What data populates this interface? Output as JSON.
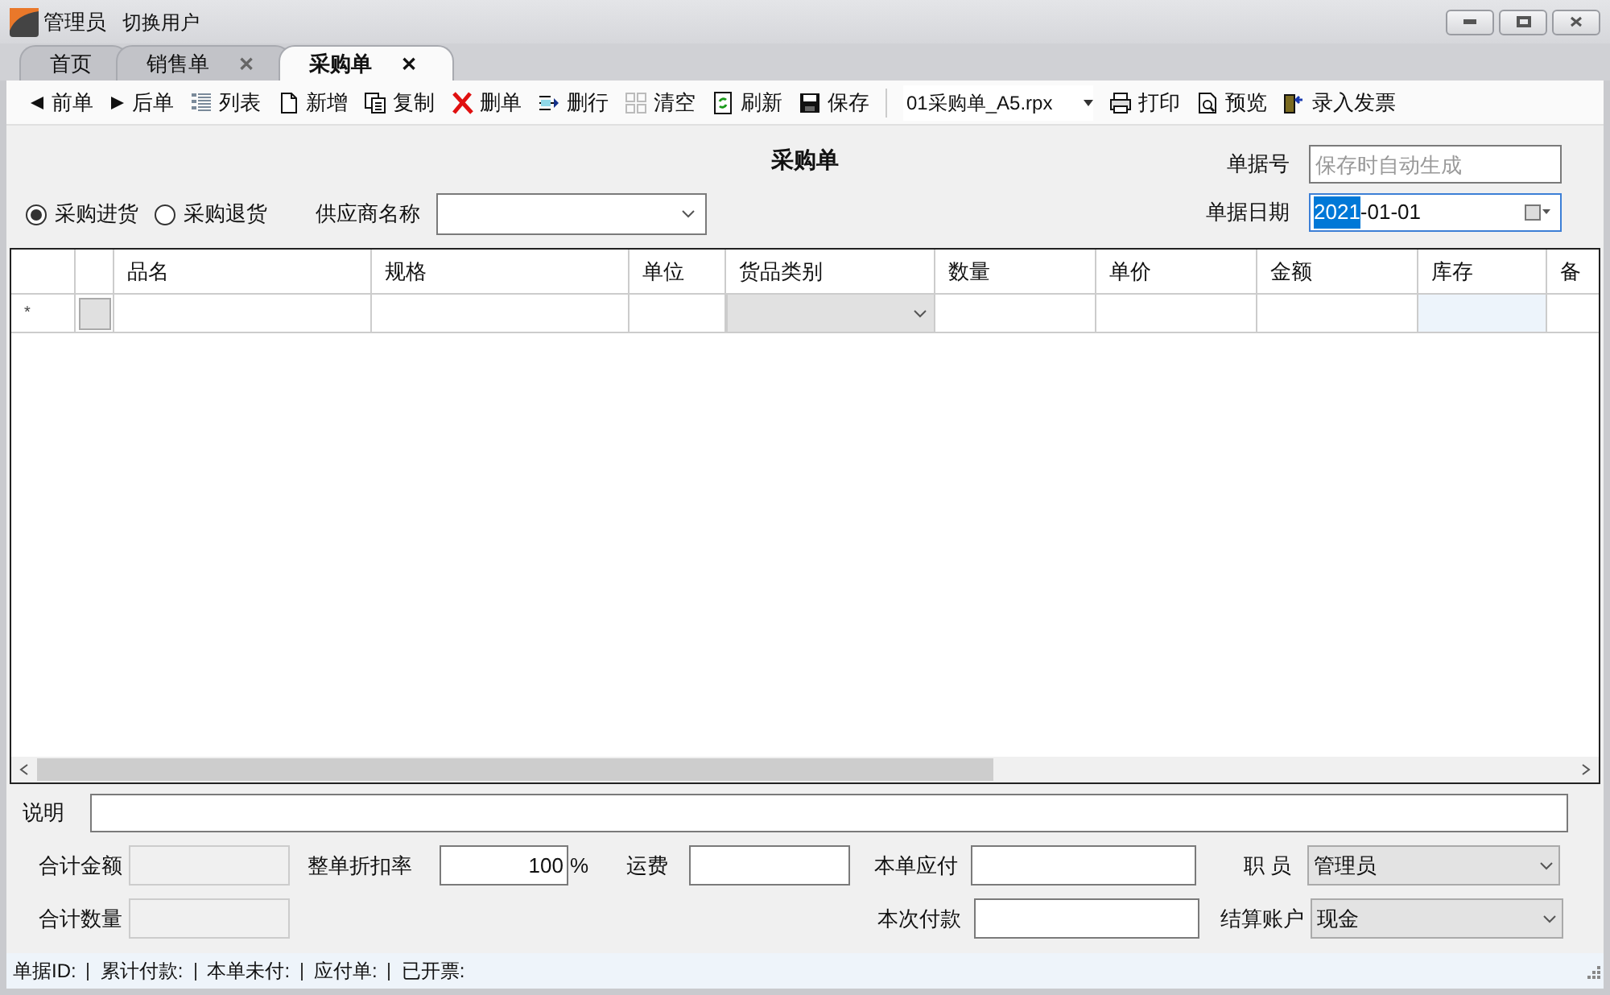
{
  "title_bar": {
    "user": "管理员",
    "switch_user": "切换用户"
  },
  "tabs": [
    {
      "label": "首页",
      "closable": false,
      "selected": false
    },
    {
      "label": "销售单",
      "closable": true,
      "selected": false
    },
    {
      "label": "采购单",
      "closable": true,
      "selected": true
    }
  ],
  "close_glyph": "✕",
  "toolbar": [
    {
      "label": "前单"
    },
    {
      "label": "后单"
    },
    {
      "label": "列表"
    },
    {
      "label": "新增"
    },
    {
      "label": "复制"
    },
    {
      "label": "删单"
    },
    {
      "label": "删行"
    },
    {
      "label": "清空"
    },
    {
      "label": "刷新"
    },
    {
      "label": "保存"
    }
  ],
  "template": {
    "value": "01采购单_A5.rpx"
  },
  "toolbar_right": [
    {
      "label": "打印"
    },
    {
      "label": "预览"
    },
    {
      "label": "录入发票"
    }
  ],
  "form_title": "采购单",
  "doc_number": {
    "label": "单据号",
    "placeholder": "保存时自动生成"
  },
  "doc_date": {
    "label": "单据日期",
    "selected_part": "2021",
    "rest": "-01-01"
  },
  "types": [
    {
      "label": "采购进货",
      "selected": true
    },
    {
      "label": "采购退货",
      "selected": false
    }
  ],
  "supplier": {
    "label": "供应商名称"
  },
  "grid": {
    "columns": [
      {
        "label": "品名",
        "kind": "text"
      },
      {
        "label": "规格",
        "kind": "text"
      },
      {
        "label": "单位",
        "kind": "text"
      },
      {
        "label": "货品类别",
        "kind": "combo"
      },
      {
        "label": "数量",
        "kind": "text"
      },
      {
        "label": "单价",
        "kind": "text"
      },
      {
        "label": "金额",
        "kind": "text"
      },
      {
        "label": "库存",
        "kind": "stock"
      },
      {
        "label": "备",
        "kind": "text"
      }
    ],
    "new_row_marker": "*",
    "new_row_checked": false
  },
  "note": {
    "label": "说明"
  },
  "totals": {
    "amount_label": "合计金额",
    "quantity_label": "合计数量",
    "discount_label": "整单折扣率",
    "discount_value": "100",
    "percent": "%",
    "freight_label": "运费",
    "payable_label": "本单应付",
    "payment_label": "本次付款",
    "staff_label": "职 员",
    "staff_value": "管理员",
    "account_label": "结算账户",
    "account_value": "现金"
  },
  "status_bar": [
    "单据ID:",
    "累计付款:",
    "本单未付:",
    "应付单:",
    "已开票:"
  ]
}
